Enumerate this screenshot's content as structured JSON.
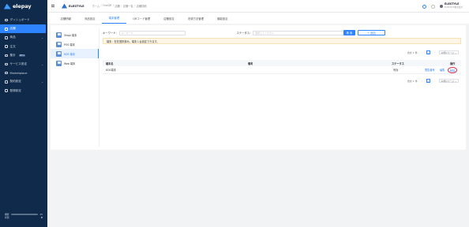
{
  "sidebar": {
    "brand": "elepay",
    "items": [
      {
        "label": "ダッシュボード",
        "icon": "dashboard-icon",
        "active": false,
        "chevron": false
      },
      {
        "label": "店舗",
        "icon": "store-icon",
        "active": true,
        "chevron": false
      },
      {
        "label": "商品",
        "icon": "product-icon",
        "active": false,
        "chevron": true
      },
      {
        "label": "注文",
        "icon": "order-icon",
        "active": false,
        "chevron": false
      },
      {
        "label": "集計",
        "icon": "report-icon",
        "active": false,
        "chevron": false,
        "badge": "BETA"
      },
      {
        "label": "サービス設定",
        "icon": "service-icon",
        "active": false,
        "chevron": true
      },
      {
        "label": "Marketplace",
        "icon": "marketplace-icon",
        "active": false,
        "chevron": false
      },
      {
        "label": "契約設定",
        "icon": "contract-icon",
        "active": false,
        "chevron": true
      },
      {
        "label": "登録設定",
        "icon": "registration-icon",
        "active": false,
        "chevron": false
      }
    ],
    "footer": {
      "line1_left": "機能",
      "line1_right": "25",
      "line2_left": "状態",
      "line2_right": "▼"
    }
  },
  "header": {
    "shop_name": "ELESTYLE",
    "breadcrumb": [
      "ホーム",
      "OneQR",
      "店舗",
      "店舗一覧",
      "店舗詳細"
    ],
    "user_name": "ELESTYLE",
    "user_email": "ELESTYLE株式会社"
  },
  "tabs": [
    {
      "label": "店舗情報",
      "active": false
    },
    {
      "label": "商品設定",
      "active": false
    },
    {
      "label": "端末管理",
      "active": true
    },
    {
      "label": "QRコード管理",
      "active": false
    },
    {
      "label": "店舗設定",
      "active": false
    },
    {
      "label": "決済方法管理",
      "active": false
    },
    {
      "label": "機能設定",
      "active": false
    }
  ],
  "terminals": [
    {
      "label": "Shopl 端末",
      "active": false
    },
    {
      "label": "POS 端末",
      "active": false
    },
    {
      "label": "KDS 端末",
      "active": true
    },
    {
      "label": "Web 端末",
      "active": false
    }
  ],
  "filter": {
    "keyword_label": "キーワード:",
    "keyword_placeholder": "キーワード",
    "status_label": "ステータス:",
    "status_placeholder": "選択してください",
    "search_button": "検 索",
    "add_button": "+ 追加"
  },
  "notice": "端末：在在選択済み。端末１台設定できます。",
  "pager": {
    "total": "合計 1 件",
    "page": "1",
    "page_size": "10件/ページ"
  },
  "table": {
    "headers": [
      "端末名",
      "備考",
      "ステータス",
      "操作"
    ],
    "rows": [
      {
        "name": "KDS端末",
        "remark": "",
        "status": "有効",
        "action_view": "閲覧番号",
        "action_edit": "編集",
        "action_delete": "削除"
      }
    ]
  }
}
